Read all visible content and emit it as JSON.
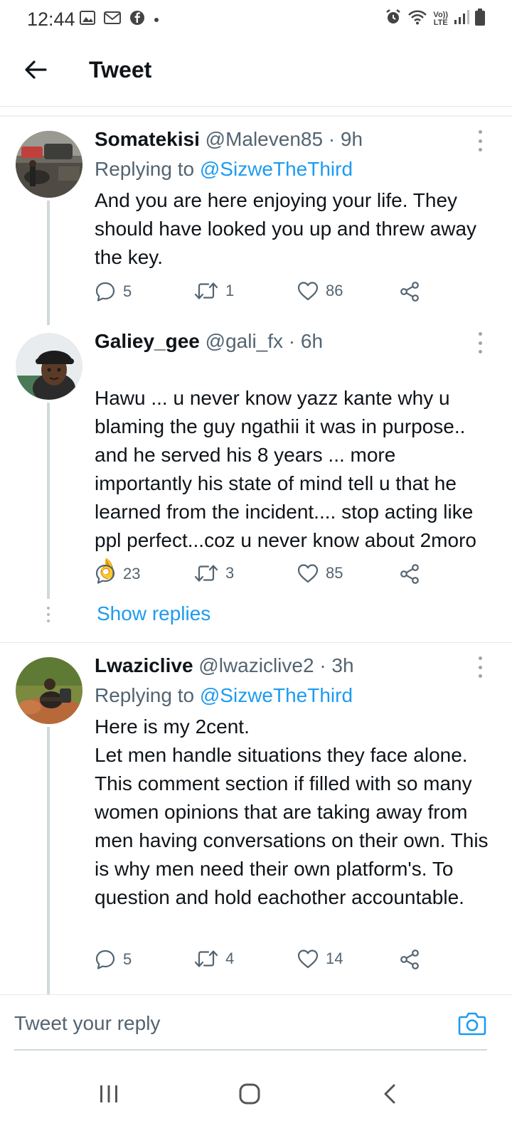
{
  "status_bar": {
    "time": "12:44",
    "left_icons": [
      "gallery-icon",
      "gmail-icon",
      "facebook-icon",
      "dot-icon"
    ],
    "right_icons": [
      "alarm-icon",
      "wifi-icon",
      "volte-icon",
      "signal-icon",
      "battery-icon"
    ],
    "volte_label_top": "Vo))",
    "volte_label_bottom": "LTE"
  },
  "header": {
    "title": "Tweet"
  },
  "tweets": [
    {
      "name": "Somatekisi",
      "handle": "@Maleven85 · 9h",
      "replying_prefix": "Replying to ",
      "replying_to": "@SizweTheThird",
      "text": "And you are here enjoying your life. They should have looked you up and threw away the key.",
      "replies": "5",
      "retweets": "1",
      "likes": "86"
    },
    {
      "name": "Galiey_gee",
      "handle": "@gali_fx · 6h",
      "text": "Hawu ... u never know yazz kante why u blaming the guy ngathii  it was in purpose.. and he served his 8 years ... more importantly his state of mind tell u that he learned from the incident.... stop acting like ppl perfect...coz u never know about 2moro",
      "emoji": "👌",
      "replies": "23",
      "retweets": "3",
      "likes": "85",
      "show_replies": "Show replies"
    },
    {
      "name": "Lwaziclive",
      "handle": "@lwaziclive2 · 3h",
      "replying_prefix": "Replying to ",
      "replying_to": "@SizweTheThird",
      "text": "Here is my 2cent.\nLet men handle situations they face alone. This comment section if filled with so many women opinions that are taking away from men having conversations on their own. This is why men need their own platform's. To question and hold eachother accountable.",
      "replies": "5",
      "retweets": "4",
      "likes": "14"
    }
  ],
  "composer": {
    "placeholder": "Tweet your reply"
  },
  "colors": {
    "accent": "#1d9bf0",
    "text": "#0f1419",
    "secondary": "#536471",
    "thread_line": "#cfd9de"
  }
}
